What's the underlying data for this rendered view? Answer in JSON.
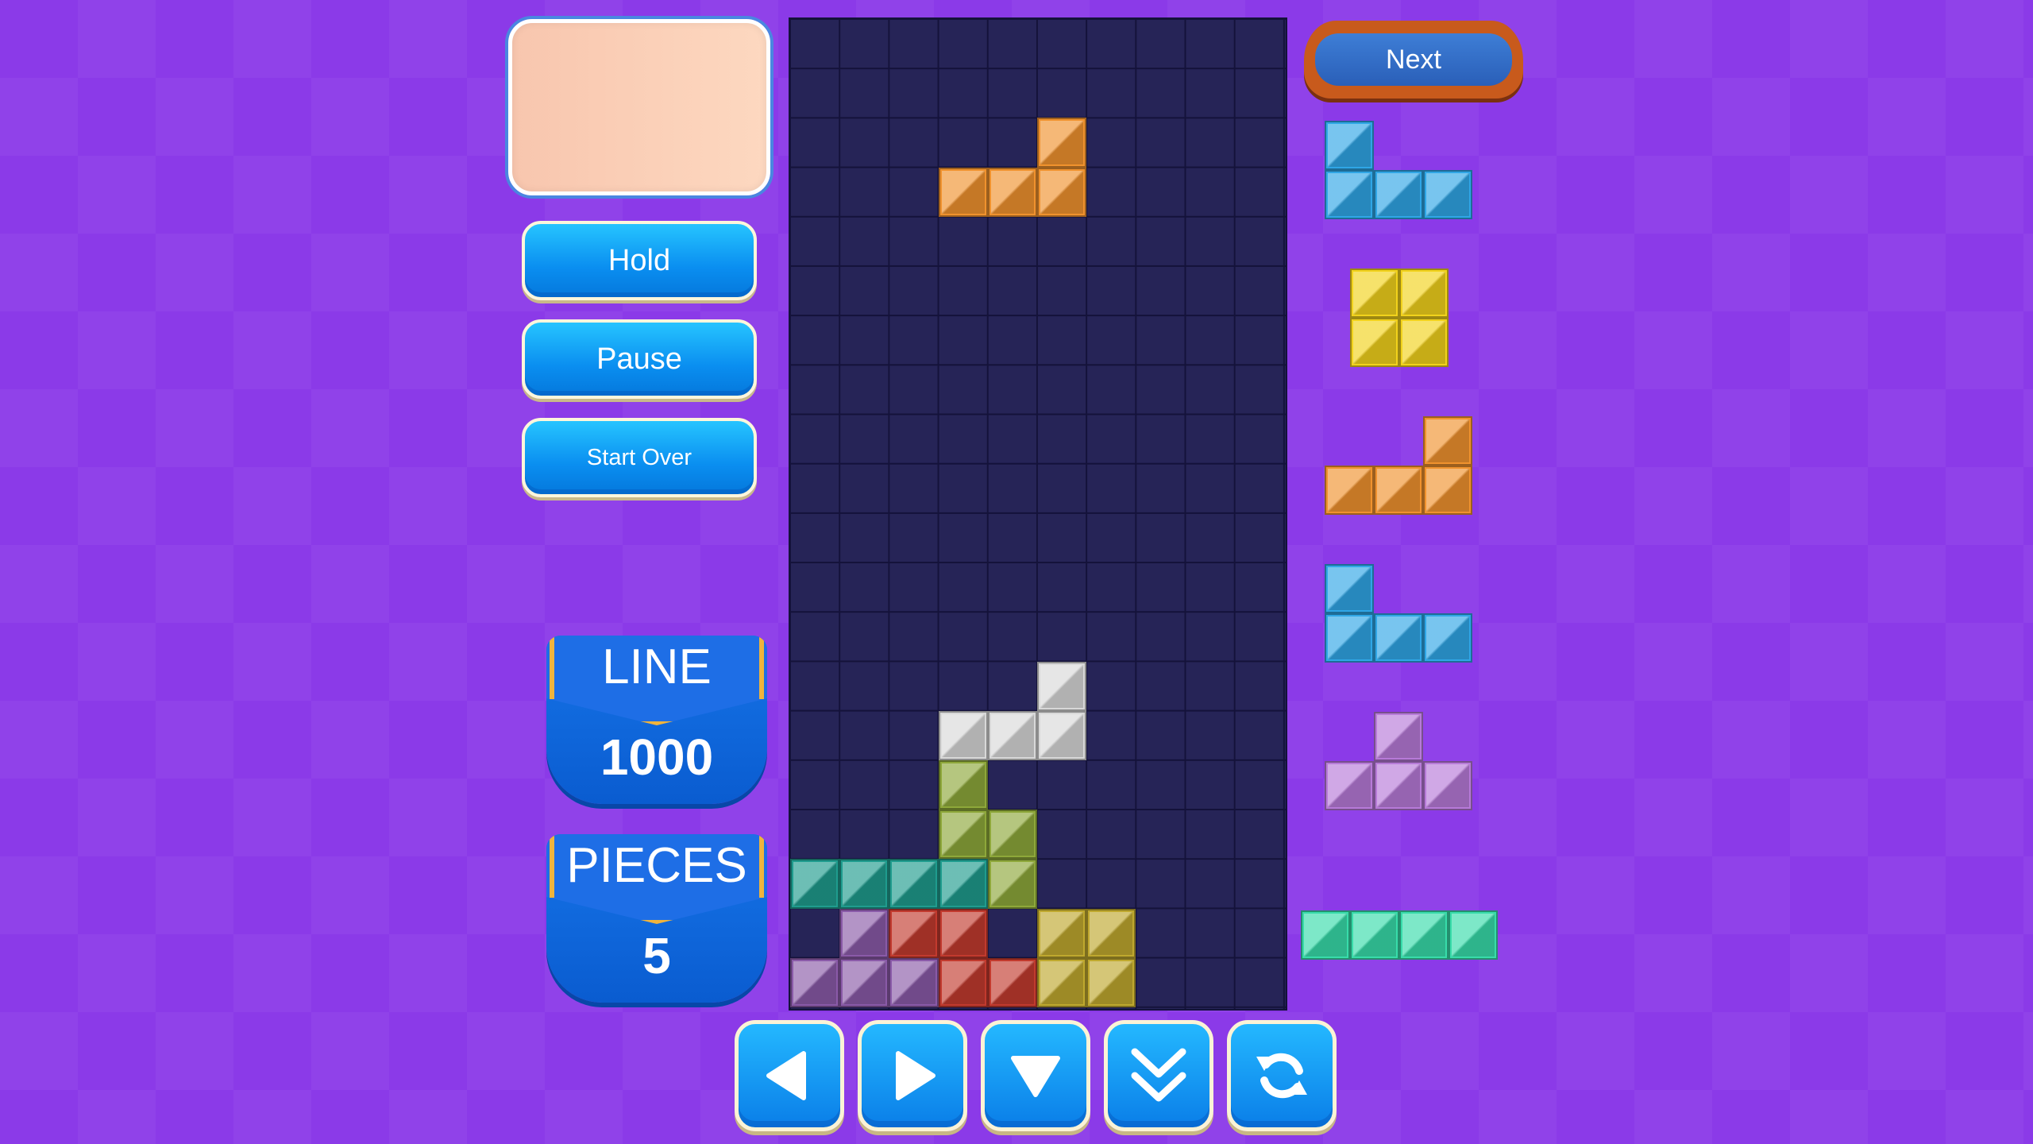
{
  "sidebar": {
    "hold_label": "Hold",
    "pause_label": "Pause",
    "start_over_label": "Start Over"
  },
  "stats": {
    "line_label": "LINE",
    "line_value": "1000",
    "pieces_label": "PIECES",
    "pieces_value": "5"
  },
  "next_label": "Next",
  "colors": {
    "orange": "#f0922e",
    "blue": "#2fa6e6",
    "yellow": "#f2d21c",
    "purple": "#b77ad8",
    "teal": "#38dcaa",
    "white": "#d8d8d8",
    "olive": "#8ea83a",
    "dark_teal": "#1f9c8e",
    "dark_purple": "#8a5aa8",
    "red": "#c23a2e",
    "gold": "#bfa82e"
  },
  "board": {
    "columns": 10,
    "rows": 20,
    "falling_piece": {
      "type": "L",
      "color": "orange",
      "cells": [
        [
          5,
          2
        ],
        [
          3,
          3
        ],
        [
          4,
          3
        ],
        [
          5,
          3
        ]
      ]
    },
    "settled_cells": [
      {
        "col": 5,
        "row": 13,
        "color": "white"
      },
      {
        "col": 3,
        "row": 14,
        "color": "white"
      },
      {
        "col": 4,
        "row": 14,
        "color": "white"
      },
      {
        "col": 5,
        "row": 14,
        "color": "white"
      },
      {
        "col": 3,
        "row": 15,
        "color": "olive"
      },
      {
        "col": 3,
        "row": 16,
        "color": "olive"
      },
      {
        "col": 4,
        "row": 16,
        "color": "olive"
      },
      {
        "col": 4,
        "row": 17,
        "color": "olive"
      },
      {
        "col": 0,
        "row": 17,
        "color": "dark_teal"
      },
      {
        "col": 1,
        "row": 17,
        "color": "dark_teal"
      },
      {
        "col": 2,
        "row": 17,
        "color": "dark_teal"
      },
      {
        "col": 3,
        "row": 17,
        "color": "dark_teal"
      },
      {
        "col": 1,
        "row": 18,
        "color": "dark_purple"
      },
      {
        "col": 2,
        "row": 18,
        "color": "red"
      },
      {
        "col": 3,
        "row": 18,
        "color": "red"
      },
      {
        "col": 5,
        "row": 18,
        "color": "gold"
      },
      {
        "col": 6,
        "row": 18,
        "color": "gold"
      },
      {
        "col": 0,
        "row": 19,
        "color": "dark_purple"
      },
      {
        "col": 1,
        "row": 19,
        "color": "dark_purple"
      },
      {
        "col": 2,
        "row": 19,
        "color": "dark_purple"
      },
      {
        "col": 3,
        "row": 19,
        "color": "red"
      },
      {
        "col": 4,
        "row": 19,
        "color": "red"
      },
      {
        "col": 5,
        "row": 19,
        "color": "gold"
      },
      {
        "col": 6,
        "row": 19,
        "color": "gold"
      }
    ]
  },
  "next_queue": [
    {
      "type": "J",
      "color": "blue",
      "cells": [
        [
          0,
          0
        ],
        [
          0,
          1
        ],
        [
          1,
          1
        ],
        [
          2,
          1
        ]
      ]
    },
    {
      "type": "O",
      "color": "yellow",
      "cells": [
        [
          0,
          0
        ],
        [
          1,
          0
        ],
        [
          0,
          1
        ],
        [
          1,
          1
        ]
      ]
    },
    {
      "type": "L",
      "color": "orange",
      "cells": [
        [
          2,
          0
        ],
        [
          0,
          1
        ],
        [
          1,
          1
        ],
        [
          2,
          1
        ]
      ]
    },
    {
      "type": "J",
      "color": "blue",
      "cells": [
        [
          0,
          0
        ],
        [
          0,
          1
        ],
        [
          1,
          1
        ],
        [
          2,
          1
        ]
      ]
    },
    {
      "type": "T",
      "color": "purple",
      "cells": [
        [
          1,
          0
        ],
        [
          0,
          1
        ],
        [
          1,
          1
        ],
        [
          2,
          1
        ]
      ]
    },
    {
      "type": "I",
      "color": "teal",
      "cells": [
        [
          0,
          0
        ],
        [
          1,
          0
        ],
        [
          2,
          0
        ],
        [
          3,
          0
        ]
      ]
    }
  ],
  "controls": [
    {
      "name": "move-left-button",
      "icon": "arrow-left-icon"
    },
    {
      "name": "move-right-button",
      "icon": "arrow-right-icon"
    },
    {
      "name": "soft-drop-button",
      "icon": "arrow-down-icon"
    },
    {
      "name": "hard-drop-button",
      "icon": "double-chevron-down-icon"
    },
    {
      "name": "rotate-button",
      "icon": "rotate-icon"
    }
  ]
}
